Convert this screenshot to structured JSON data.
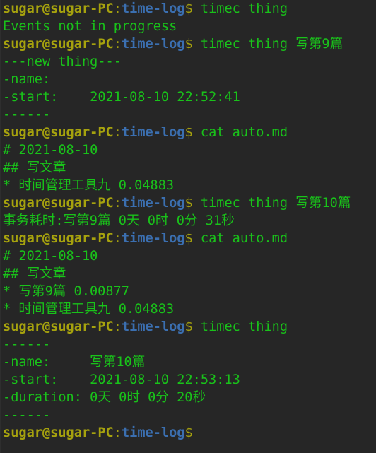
{
  "prompt": {
    "user": "sugar@sugar-PC",
    "colon": ":",
    "path": "time-log",
    "dollar": "$ "
  },
  "colors": {
    "background": "#262626",
    "user": "#a6a20e",
    "path": "#3b6fb0",
    "text": "#19c21a"
  },
  "lines": [
    {
      "type": "prompt",
      "cmd": "timec thing"
    },
    {
      "type": "out",
      "text": "Events not in progress"
    },
    {
      "type": "prompt",
      "cmd": "timec thing 写第9篇"
    },
    {
      "type": "out",
      "text": "---new thing---"
    },
    {
      "type": "out",
      "text": "-name:"
    },
    {
      "type": "out",
      "text": "-start:    2021-08-10 22:52:41"
    },
    {
      "type": "out",
      "text": "------"
    },
    {
      "type": "prompt",
      "cmd": "cat auto.md"
    },
    {
      "type": "out",
      "text": "# 2021-08-10"
    },
    {
      "type": "out",
      "text": "## 写文章"
    },
    {
      "type": "out",
      "text": "* 时间管理工具九 0.04883"
    },
    {
      "type": "prompt",
      "cmd": "timec thing 写第10篇"
    },
    {
      "type": "out",
      "text": "事务耗时:写第9篇 0天 0时 0分 31秒"
    },
    {
      "type": "prompt",
      "cmd": "cat auto.md"
    },
    {
      "type": "out",
      "text": "# 2021-08-10"
    },
    {
      "type": "out",
      "text": "## 写文章"
    },
    {
      "type": "out",
      "text": "* 写第9篇 0.00877"
    },
    {
      "type": "out",
      "text": "* 时间管理工具九 0.04883"
    },
    {
      "type": "prompt",
      "cmd": "timec thing"
    },
    {
      "type": "out",
      "text": "------"
    },
    {
      "type": "out",
      "text": "-name:     写第10篇"
    },
    {
      "type": "out",
      "text": "-start:    2021-08-10 22:53:13"
    },
    {
      "type": "out",
      "text": "-duration: 0天 0时 0分 20秒"
    },
    {
      "type": "out",
      "text": "------"
    },
    {
      "type": "prompt",
      "cmd": ""
    }
  ]
}
